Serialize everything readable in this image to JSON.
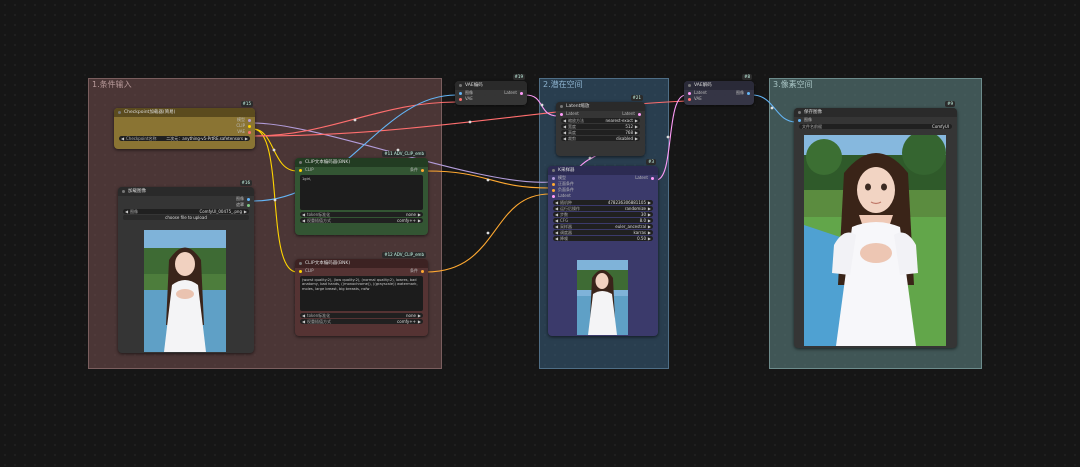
{
  "groups": [
    {
      "id": "g1",
      "title": "1.条件输入"
    },
    {
      "id": "g2",
      "title": "2.潜在空间"
    },
    {
      "id": "g3",
      "title": "3.像素空间"
    }
  ],
  "colors": {
    "wire_model": "#b39ddb",
    "wire_clip": "#ffd500",
    "wire_vae": "#ff6e6e",
    "wire_latent": "#ff9cf9",
    "wire_image": "#64b5f6",
    "wire_conditioning": "#ffa931"
  },
  "nodes": {
    "checkpoint": {
      "badge": "#15",
      "title": "Checkpoint加载器(简易)",
      "outputs": [
        "模型",
        "CLIP",
        "VAE"
      ],
      "widgets": [
        {
          "label": "Checkpoint名称",
          "value": "二次元：anything-v5-PrtRE.safetensors"
        }
      ]
    },
    "load_image": {
      "badge": "#16",
      "title": "加载图像",
      "outputs": [
        "图像",
        "遮罩"
      ],
      "widgets": [
        {
          "label": "图像",
          "value": "ComfyUI_00475_.png"
        }
      ],
      "upload_label": "choose file to upload"
    },
    "vae_encode": {
      "badge": "#19",
      "title": "VAE编码",
      "inputs": [
        "图像",
        "VAE"
      ],
      "outputs": [
        "Latent"
      ]
    },
    "clip_pos": {
      "badge": "#11 ADV_CLIP_emb",
      "title": "CLIP文本编码器(BNK)",
      "inputs": [
        "CLIP"
      ],
      "outputs": [
        "条件"
      ],
      "text": "1girl,",
      "widgets": [
        {
          "label": "token标准化",
          "value": "none"
        },
        {
          "label": "权重插值方式",
          "value": "comfy++"
        }
      ]
    },
    "clip_neg": {
      "badge": "#12 ADV_CLIP_emb",
      "title": "CLIP文本编码器(BNK)",
      "inputs": [
        "CLIP"
      ],
      "outputs": [
        "条件"
      ],
      "text": "(worst quality:2), (low quality:2), (normal quality:2), lowres, bad anatomy, bad hands, ((monochrome)), ((grayscale)) watermark, moles, large breast, big breasts, nsfw",
      "widgets": [
        {
          "label": "token标准化",
          "value": "none"
        },
        {
          "label": "权重插值方式",
          "value": "comfy++"
        }
      ]
    },
    "latent_scale": {
      "badge": "#21",
      "title": "Latent缩放",
      "inputs": [
        "Latent"
      ],
      "outputs": [
        "Latent"
      ],
      "widgets": [
        {
          "label": "缩放方法",
          "value": "nearest-exact"
        },
        {
          "label": "宽度",
          "value": "512"
        },
        {
          "label": "高度",
          "value": "768"
        },
        {
          "label": "裁剪",
          "value": "disabled"
        }
      ]
    },
    "ksampler": {
      "badge": "#3",
      "title": "K采样器",
      "inputs": [
        "模型",
        "正面条件",
        "负面条件",
        "Latent"
      ],
      "outputs": [
        "Latent"
      ],
      "widgets": [
        {
          "label": "随机种",
          "value": "478236306881105"
        },
        {
          "label": "运行后操作",
          "value": "randomize"
        },
        {
          "label": "步数",
          "value": "30"
        },
        {
          "label": "CFG",
          "value": "8.0"
        },
        {
          "label": "采样器",
          "value": "euler_ancestral"
        },
        {
          "label": "调度器",
          "value": "karras"
        },
        {
          "label": "降噪",
          "value": "0.50"
        }
      ]
    },
    "vae_decode": {
      "badge": "#8",
      "title": "VAE解码",
      "inputs": [
        "Latent",
        "VAE"
      ],
      "outputs": [
        "图像"
      ]
    },
    "save_image": {
      "badge": "#9",
      "title": "保存图像",
      "inputs": [
        "图像"
      ],
      "widgets": [
        {
          "label": "文件名前缀",
          "value": "ComfyUI"
        }
      ]
    }
  }
}
